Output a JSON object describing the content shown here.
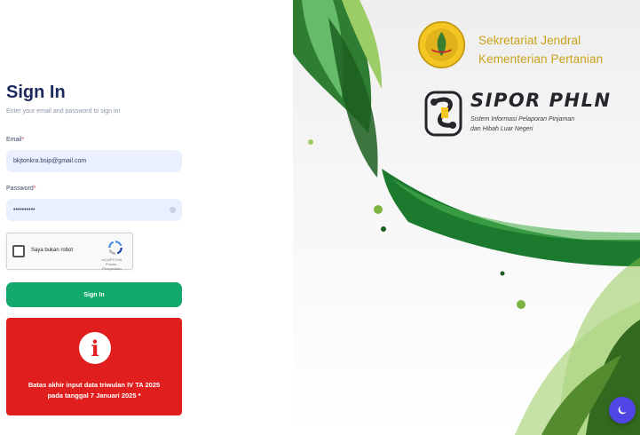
{
  "signin": {
    "title": "Sign In",
    "subtitle": "Enter your email and password to sign in!",
    "email_label": "Email",
    "email_value": "bkjtonkra.bsip@gmail.com",
    "password_label": "Password",
    "password_value": "••••••••••",
    "required_mark": "*",
    "captcha_label": "Saya bukan robot",
    "captcha_brand": "reCAPTCHA",
    "captcha_links": "Privasi - Persyaratan",
    "signin_button": "Sign In"
  },
  "alert": {
    "icon": "info-icon",
    "message_line1": "Batas akhir input data triwulan IV TA 2025",
    "message_line2": "pada tanggal 7 Januari 2025 *"
  },
  "brand": {
    "org_line1": "Sekretariat Jendral",
    "org_line2": "Kementerian Pertanian",
    "app_name": "SIPOR PHLN",
    "app_desc_line1": "Sistem Informasi Pelaporan Pinjaman",
    "app_desc_line2": "dan Hibah Luar Negeri"
  },
  "colors": {
    "primary_button": "#13a96c",
    "alert_bg": "#e01e1e",
    "input_bg": "#eaf0ff",
    "title": "#1d2a5c",
    "org_text": "#c9a21a",
    "theme_toggle": "#4f46e5"
  }
}
